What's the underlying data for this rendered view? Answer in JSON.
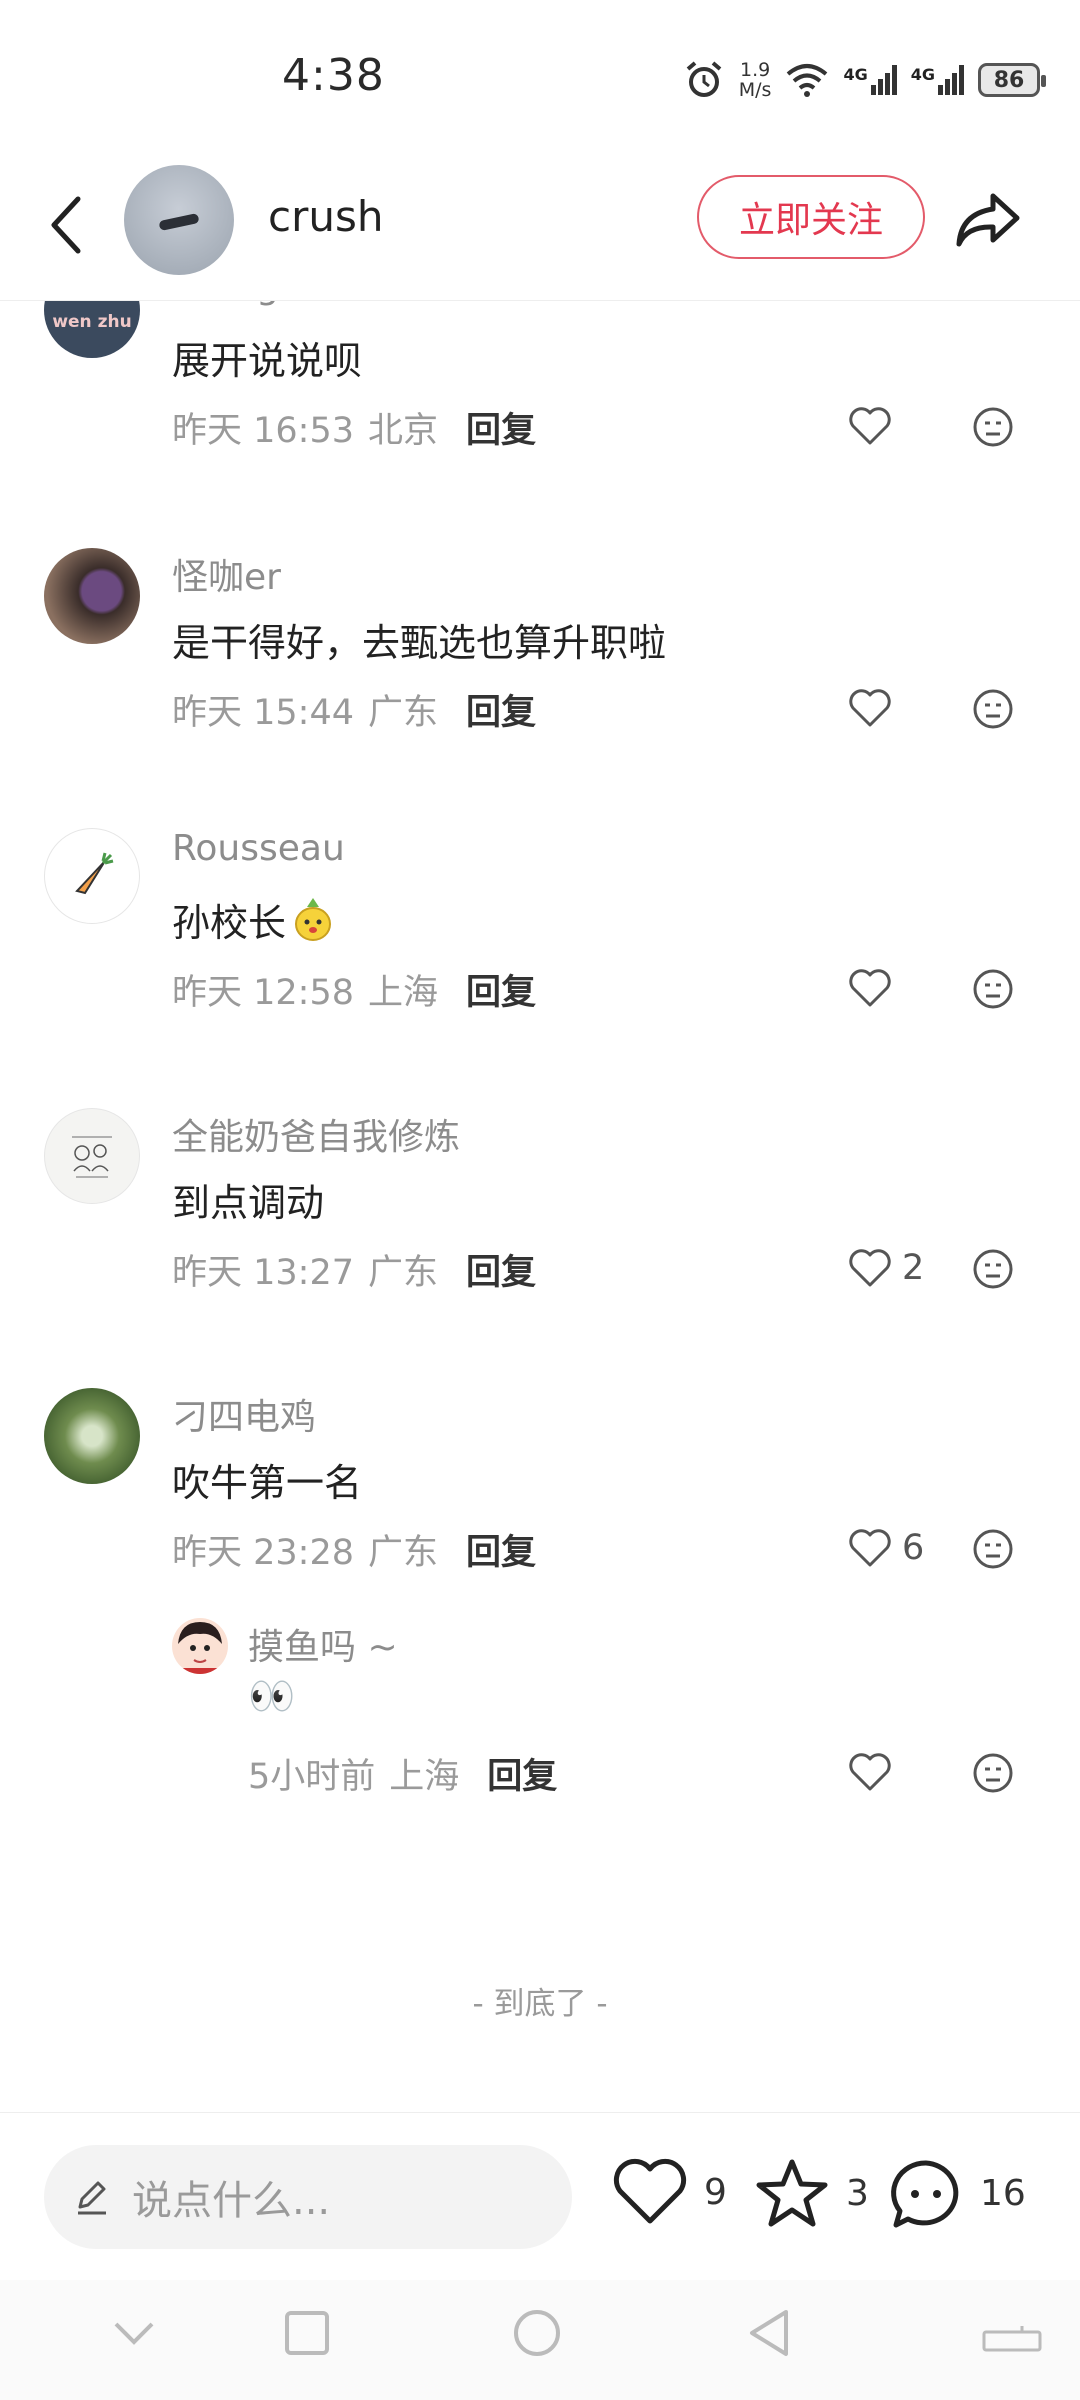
{
  "status_bar": {
    "time": "4:38",
    "speed_value": "1.9",
    "speed_unit": "M/s",
    "network1": "4G",
    "network2": "4G",
    "battery": "86"
  },
  "header": {
    "username": "crush",
    "follow_label": "立即关注"
  },
  "comments": [
    {
      "username": "savage",
      "avatar_text": "wen zhu",
      "content": "展开说说呗",
      "time": "昨天 16:53",
      "location": "北京",
      "reply_label": "回复",
      "likes": ""
    },
    {
      "username": "怪咖er",
      "content": "是干得好，去甄选也算升职啦",
      "time": "昨天 15:44",
      "location": "广东",
      "reply_label": "回复",
      "likes": ""
    },
    {
      "username": "Rousseau",
      "content": "孙校长",
      "time": "昨天 12:58",
      "location": "上海",
      "reply_label": "回复",
      "likes": ""
    },
    {
      "username": "全能奶爸自我修炼",
      "content": "到点调动",
      "time": "昨天 13:27",
      "location": "广东",
      "reply_label": "回复",
      "likes": "2"
    },
    {
      "username": "刁四电鸡",
      "content": "吹牛第一名",
      "time": "昨天 23:28",
      "location": "广东",
      "reply_label": "回复",
      "likes": "6"
    }
  ],
  "reply": {
    "username": "摸鱼吗 ~",
    "content": "👀",
    "time": "5小时前",
    "location": "上海",
    "reply_label": "回复",
    "likes": ""
  },
  "end_text": "- 到底了 -",
  "bottom_bar": {
    "input_placeholder": "说点什么...",
    "like_count": "9",
    "star_count": "3",
    "comment_count": "16"
  },
  "colors": {
    "accent": "#e3384f",
    "text_primary": "#222222",
    "text_secondary": "#9a9a9a"
  }
}
